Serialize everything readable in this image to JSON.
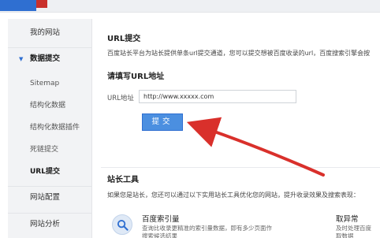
{
  "sidebar": {
    "items": [
      {
        "label": "我的网站"
      },
      {
        "label": "数据提交",
        "expanded": true
      },
      {
        "label": "Sitemap"
      },
      {
        "label": "结构化数据"
      },
      {
        "label": "结构化数据插件"
      },
      {
        "label": "死链提交"
      },
      {
        "label": "URL提交",
        "active": true
      },
      {
        "label": "网站配置"
      },
      {
        "label": "网站分析"
      }
    ]
  },
  "main": {
    "section_title": "URL提交",
    "description": "百度站长平台为站长提供单条url提交通道，您可以提交想被百度收录的url，百度搜索引擎会按",
    "form_title": "请填写URL地址",
    "field_label": "URL地址",
    "url_value": "http://www.xxxxx.com",
    "submit_label": "提交",
    "tools_title": "站长工具",
    "tools_description": "如果您是站长，您还可以通过以下实用站长工具优化您的网站，提升收录效果及搜索表现：",
    "tools": [
      {
        "icon": "search-icon",
        "title": "百度索引量",
        "desc_lines": [
          "查询比收录更精准的索引量数据，即有多少页面作",
          "搜索候选结果"
        ]
      },
      {
        "icon": "",
        "title": "取异常",
        "desc_lines": [
          "及时处理百度",
          "取数据"
        ]
      }
    ]
  },
  "colors": {
    "accent": "#4b8fe0",
    "arrow": "#d9302b",
    "sidebar_bg": "#f2f3f5"
  }
}
